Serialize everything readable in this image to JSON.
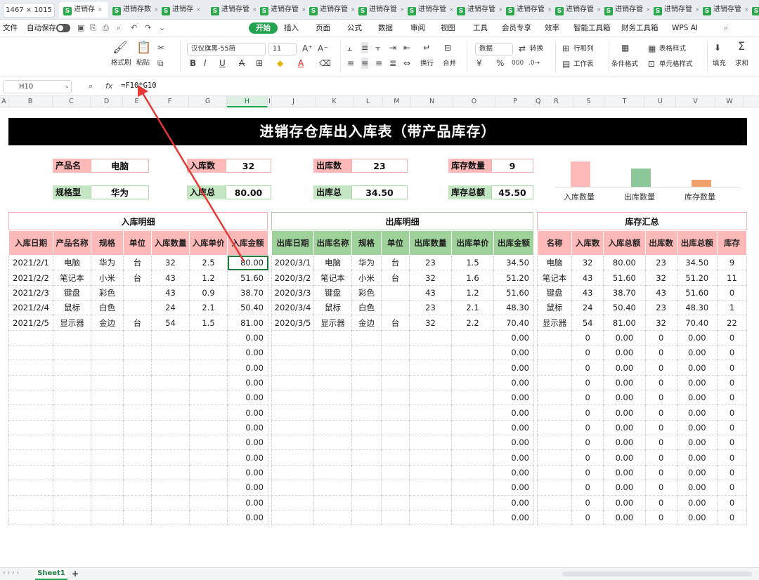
{
  "screenshot_badge": "1467 × 1015",
  "tabs": [
    {
      "label": "进销存",
      "active": true
    },
    {
      "label": "进销存数"
    },
    {
      "label": "进销存"
    },
    {
      "label": "进销存管"
    },
    {
      "label": "进销存管"
    },
    {
      "label": "进销存管"
    },
    {
      "label": "进销存管"
    },
    {
      "label": "进销存管"
    },
    {
      "label": "进销存管"
    },
    {
      "label": "进销存管"
    },
    {
      "label": "进销存管"
    },
    {
      "label": "进销存管"
    },
    {
      "label": "进销存管"
    },
    {
      "label": "进销存管"
    },
    {
      "label": "进销存管"
    }
  ],
  "menubar": {
    "file": "文件",
    "autosave": "自动保存",
    "items": [
      "开始",
      "插入",
      "页面",
      "公式",
      "数据",
      "审阅",
      "视图",
      "工具",
      "会员专享",
      "效率",
      "智能工具箱",
      "财务工具箱",
      "WPS AI"
    ]
  },
  "ribbon": {
    "format_painter": "格式刷",
    "paste": "粘贴",
    "font_name": "汉仪旗黑-55简",
    "font_size": "11",
    "number_format": "数据",
    "convert": "转换",
    "row_col": "行和列",
    "table_style": "表格样式",
    "worksheet": "工作表",
    "cond_format": "条件格式",
    "cell_style": "单元格样式",
    "wrap": "换行",
    "merge": "合并",
    "fill": "填充",
    "sum": "求和"
  },
  "formula_bar": {
    "cell_ref": "H10",
    "fx": "fx",
    "formula": "=F10*G10"
  },
  "columns": [
    "A",
    "B",
    "C",
    "D",
    "E",
    "F",
    "G",
    "H",
    "I",
    "J",
    "K",
    "L",
    "M",
    "N",
    "O",
    "P",
    "Q",
    "R",
    "S",
    "T",
    "U",
    "V",
    "W"
  ],
  "sheet_title": "进销存仓库出入库表（带产品库存）",
  "kpi": {
    "product_label": "产品名",
    "product_value": "电脑",
    "spec_label": "规格型",
    "spec_value": "华为",
    "in_qty_label": "入库数",
    "in_qty_value": "32",
    "in_total_label": "入库总",
    "in_total_value": "80.00",
    "out_qty_label": "出库数",
    "out_qty_value": "23",
    "out_total_label": "出库总",
    "out_total_value": "34.50",
    "stock_qty_label": "库存数量",
    "stock_qty_value": "9",
    "stock_total_label": "库存总额",
    "stock_total_value": "45.50"
  },
  "mini_chart": {
    "labels": [
      "入库数量",
      "出库数量",
      "库存数量"
    ],
    "values": [
      32,
      23,
      9
    ],
    "colors": [
      "#ffb9b9",
      "#8cc79a",
      "#f0a06a"
    ]
  },
  "inbound": {
    "title": "入库明细",
    "headers": [
      "入库日期",
      "产品名称",
      "规格",
      "单位",
      "入库数量",
      "入库单价",
      "入库金额"
    ],
    "rows": [
      [
        "2021/2/1",
        "电脑",
        "华为",
        "台",
        "32",
        "2.5",
        "80.00"
      ],
      [
        "2021/2/2",
        "笔记本",
        "小米",
        "台",
        "43",
        "1.2",
        "51.60"
      ],
      [
        "2021/2/3",
        "键盘",
        "彩色",
        "",
        "43",
        "0.9",
        "38.70"
      ],
      [
        "2021/2/4",
        "鼠标",
        "白色",
        "",
        "24",
        "2.1",
        "50.40"
      ],
      [
        "2021/2/5",
        "显示器",
        "金边",
        "台",
        "54",
        "1.5",
        "81.00"
      ],
      [
        "",
        "",
        "",
        "",
        "",
        "",
        "0.00"
      ],
      [
        "",
        "",
        "",
        "",
        "",
        "",
        "0.00"
      ],
      [
        "",
        "",
        "",
        "",
        "",
        "",
        "0.00"
      ],
      [
        "",
        "",
        "",
        "",
        "",
        "",
        "0.00"
      ],
      [
        "",
        "",
        "",
        "",
        "",
        "",
        "0.00"
      ],
      [
        "",
        "",
        "",
        "",
        "",
        "",
        "0.00"
      ],
      [
        "",
        "",
        "",
        "",
        "",
        "",
        "0.00"
      ],
      [
        "",
        "",
        "",
        "",
        "",
        "",
        "0.00"
      ],
      [
        "",
        "",
        "",
        "",
        "",
        "",
        "0.00"
      ],
      [
        "",
        "",
        "",
        "",
        "",
        "",
        "0.00"
      ],
      [
        "",
        "",
        "",
        "",
        "",
        "",
        "0.00"
      ],
      [
        "",
        "",
        "",
        "",
        "",
        "",
        "0.00"
      ],
      [
        "",
        "",
        "",
        "",
        "",
        "",
        "0.00"
      ]
    ]
  },
  "outbound": {
    "title": "出库明细",
    "headers": [
      "出库日期",
      "出库名称",
      "规格",
      "单位",
      "出库数量",
      "出库单价",
      "出库金额"
    ],
    "rows": [
      [
        "2020/3/1",
        "电脑",
        "华为",
        "台",
        "23",
        "1.5",
        "34.50"
      ],
      [
        "2020/3/2",
        "笔记本",
        "小米",
        "台",
        "32",
        "1.6",
        "51.20"
      ],
      [
        "2020/3/3",
        "键盘",
        "彩色",
        "",
        "43",
        "1.2",
        "51.60"
      ],
      [
        "2020/3/4",
        "鼠标",
        "白色",
        "",
        "23",
        "2.1",
        "48.30"
      ],
      [
        "2020/3/5",
        "显示器",
        "金边",
        "台",
        "32",
        "2.2",
        "70.40"
      ],
      [
        "",
        "",
        "",
        "",
        "",
        "",
        "0.00"
      ],
      [
        "",
        "",
        "",
        "",
        "",
        "",
        "0.00"
      ],
      [
        "",
        "",
        "",
        "",
        "",
        "",
        "0.00"
      ],
      [
        "",
        "",
        "",
        "",
        "",
        "",
        "0.00"
      ],
      [
        "",
        "",
        "",
        "",
        "",
        "",
        "0.00"
      ],
      [
        "",
        "",
        "",
        "",
        "",
        "",
        "0.00"
      ],
      [
        "",
        "",
        "",
        "",
        "",
        "",
        "0.00"
      ],
      [
        "",
        "",
        "",
        "",
        "",
        "",
        "0.00"
      ],
      [
        "",
        "",
        "",
        "",
        "",
        "",
        "0.00"
      ],
      [
        "",
        "",
        "",
        "",
        "",
        "",
        "0.00"
      ],
      [
        "",
        "",
        "",
        "",
        "",
        "",
        "0.00"
      ],
      [
        "",
        "",
        "",
        "",
        "",
        "",
        "0.00"
      ],
      [
        "",
        "",
        "",
        "",
        "",
        "",
        "0.00"
      ]
    ]
  },
  "summary": {
    "title": "库存汇总",
    "headers": [
      "名称",
      "入库数",
      "入库总额",
      "出库数",
      "出库总额",
      "库存"
    ],
    "rows": [
      [
        "电脑",
        "32",
        "80.00",
        "23",
        "34.50",
        "9"
      ],
      [
        "笔记本",
        "43",
        "51.60",
        "32",
        "51.20",
        "11"
      ],
      [
        "键盘",
        "43",
        "38.70",
        "43",
        "51.60",
        "0"
      ],
      [
        "鼠标",
        "24",
        "50.40",
        "23",
        "48.30",
        "1"
      ],
      [
        "显示器",
        "54",
        "81.00",
        "32",
        "70.40",
        "22"
      ],
      [
        "",
        "0",
        "0.00",
        "0",
        "0.00",
        "0"
      ],
      [
        "",
        "0",
        "0.00",
        "0",
        "0.00",
        "0"
      ],
      [
        "",
        "0",
        "0.00",
        "0",
        "0.00",
        "0"
      ],
      [
        "",
        "0",
        "0.00",
        "0",
        "0.00",
        "0"
      ],
      [
        "",
        "0",
        "0.00",
        "0",
        "0.00",
        "0"
      ],
      [
        "",
        "0",
        "0.00",
        "0",
        "0.00",
        "0"
      ],
      [
        "",
        "0",
        "0.00",
        "0",
        "0.00",
        "0"
      ],
      [
        "",
        "0",
        "0.00",
        "0",
        "0.00",
        "0"
      ],
      [
        "",
        "0",
        "0.00",
        "0",
        "0.00",
        "0"
      ],
      [
        "",
        "0",
        "0.00",
        "0",
        "0.00",
        "0"
      ],
      [
        "",
        "0",
        "0.00",
        "0",
        "0.00",
        "0"
      ],
      [
        "",
        "0",
        "0.00",
        "0",
        "0.00",
        "0"
      ],
      [
        "",
        "0",
        "0.00",
        "0",
        "0.00",
        "0"
      ]
    ]
  },
  "status": {
    "sheet_tab": "Sheet1",
    "add": "+"
  }
}
